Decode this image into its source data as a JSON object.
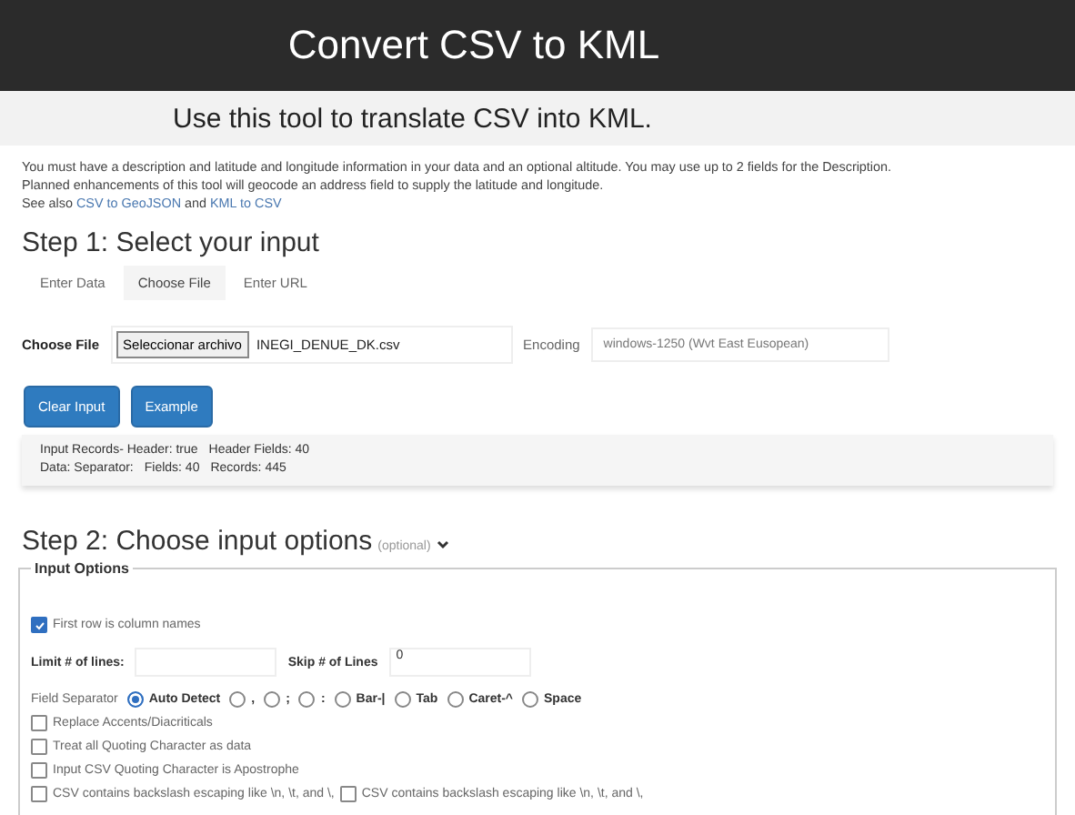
{
  "header": {
    "title": "Convert CSV to KML"
  },
  "subtitle": "Use this tool to translate CSV into KML.",
  "intro": [
    "You must have a description and latitude and longitude information in your data and an optional altitude. You may use up to 2 fields for the Description.",
    "Planned enhancements of this tool will geocode an address field to supply the latitude and longitude."
  ],
  "see_also": {
    "prefix": "See also",
    "links": [
      "CSV to GeoJSON",
      "KML to CSV"
    ],
    "joiner": "and"
  },
  "step1": {
    "title": "Step 1: Select your input",
    "tabs": [
      {
        "label": "Enter Data",
        "selected": false
      },
      {
        "label": "Choose File",
        "selected": true
      },
      {
        "label": "Enter URL",
        "selected": false
      }
    ],
    "file_label": "Choose File",
    "file_button": "Seleccionar archivo",
    "file_name": "INEGI_DENUE_DK.csv",
    "encoding_label": "Encoding",
    "encoding_value": "windows-1250 (Wvt East Eusopean)",
    "buttons": [
      "Clear Input",
      "Example"
    ],
    "info": [
      [
        "Input Records- Header: true",
        "Header Fields: 40"
      ],
      [
        "Data: Separator:",
        "Fields: 40",
        "Records: 445"
      ]
    ]
  },
  "step2": {
    "title": "Step 2: Choose input options",
    "optional": "(optional)",
    "fieldset": "Input Options",
    "first_row": {
      "label": "First row is column names",
      "checked": true
    },
    "limit_label": "Limit # of lines:",
    "skip_label": "Skip # of Lines",
    "skip_value": "0",
    "separator_label": "Field Separator",
    "separators": [
      {
        "label": "Auto Detect",
        "selected": true
      },
      {
        "label": ",",
        "selected": false
      },
      {
        "label": ";",
        "selected": false
      },
      {
        "label": ":",
        "selected": false
      },
      {
        "label": "Bar-|",
        "selected": false
      },
      {
        "label": "Tab",
        "selected": false
      },
      {
        "label": "Caret-^",
        "selected": false
      },
      {
        "label": "Space",
        "selected": false
      }
    ],
    "options": [
      [
        {
          "label": "Replace Accents/Diacriticals",
          "checked": false
        }
      ],
      [
        {
          "label": "Treat all Quoting Character as data",
          "checked": false
        }
      ],
      [
        {
          "label": "Input CSV Quoting Character is Apostrophe",
          "checked": false
        }
      ],
      [
        {
          "label": "CSV contains backslash escaping like \\n, \\t, and \\,",
          "checked": false
        },
        {
          "label": "CSV contains backslash escaping like \\n, \\t, and \\,",
          "checked": false
        }
      ]
    ]
  }
}
